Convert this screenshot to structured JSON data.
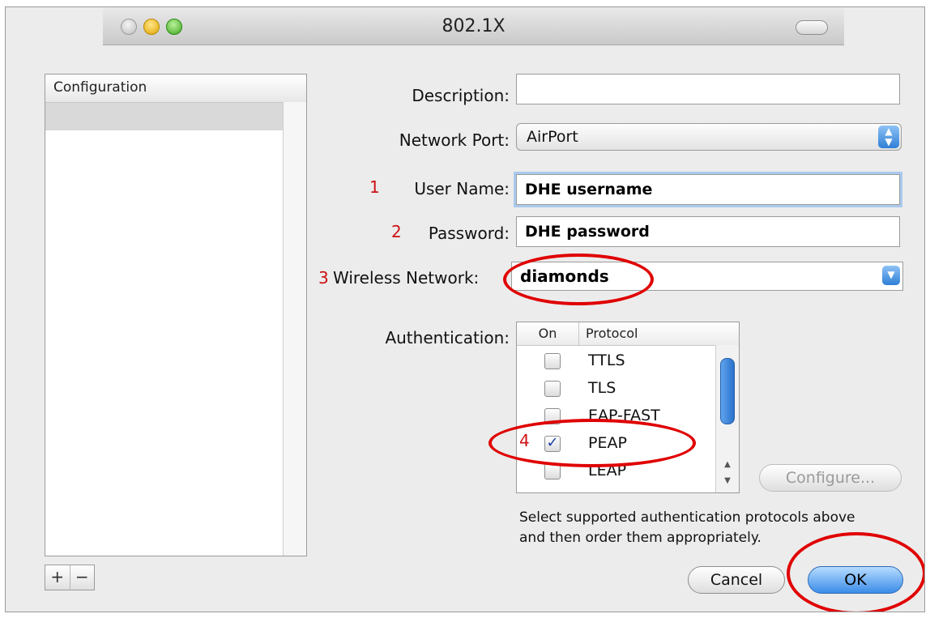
{
  "window": {
    "title": "802.1X"
  },
  "sidebar": {
    "header": "Configuration",
    "add_label": "+",
    "remove_label": "−"
  },
  "form": {
    "description_label": "Description:",
    "description_value": "",
    "network_port_label": "Network Port:",
    "network_port_value": "AirPort",
    "user_name_label": "User Name:",
    "user_name_value": "DHE username",
    "password_label": "Password:",
    "password_value": "DHE password",
    "wireless_network_label": "Wireless Network:",
    "wireless_network_value": "diamonds",
    "authentication_label": "Authentication:"
  },
  "annotations": {
    "m1": "1",
    "m2": "2",
    "m3": "3",
    "m4": "4"
  },
  "protocols": {
    "col_on": "On",
    "col_protocol": "Protocol",
    "rows": [
      {
        "name": "TTLS",
        "checked": ""
      },
      {
        "name": "TLS",
        "checked": ""
      },
      {
        "name": "EAP-FAST",
        "checked": ""
      },
      {
        "name": "PEAP",
        "checked": "✓"
      },
      {
        "name": "LEAP",
        "checked": ""
      }
    ]
  },
  "buttons": {
    "configure": "Configure...",
    "cancel": "Cancel",
    "ok": "OK"
  },
  "help_text": {
    "line1": "Select supported authentication protocols above",
    "line2": "and then order them appropriately."
  },
  "colors": {
    "annotation": "#e00000",
    "marker": "#cc1111",
    "accent": "#3b8ce8"
  }
}
